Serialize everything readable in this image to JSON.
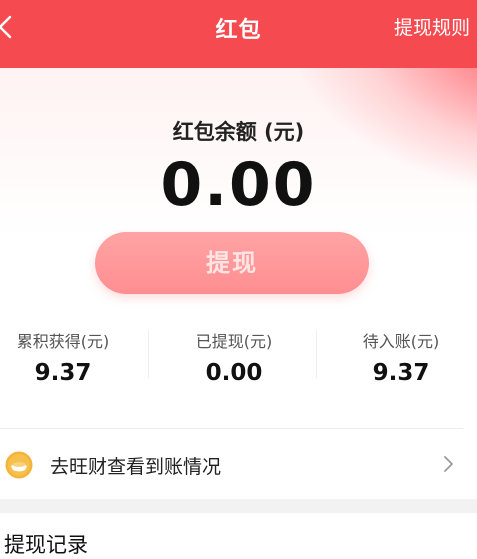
{
  "header": {
    "title": "红包",
    "rules_link": "提现规则"
  },
  "balance": {
    "label": "红包余额 (元)",
    "value": "0.00",
    "withdraw_button": "提现"
  },
  "stats": [
    {
      "label": "累积获得(元)",
      "value": "9.37"
    },
    {
      "label": "已提现(元)",
      "value": "0.00"
    },
    {
      "label": "待入账(元)",
      "value": "9.37"
    }
  ],
  "link_row": {
    "icon": "coin-icon",
    "text": "去旺财查看到账情况"
  },
  "records": {
    "title": "提现记录"
  },
  "colors": {
    "header_bg": "#f54a50",
    "button_bg": "#ff9a9c",
    "divider": "#f2f2f2"
  }
}
